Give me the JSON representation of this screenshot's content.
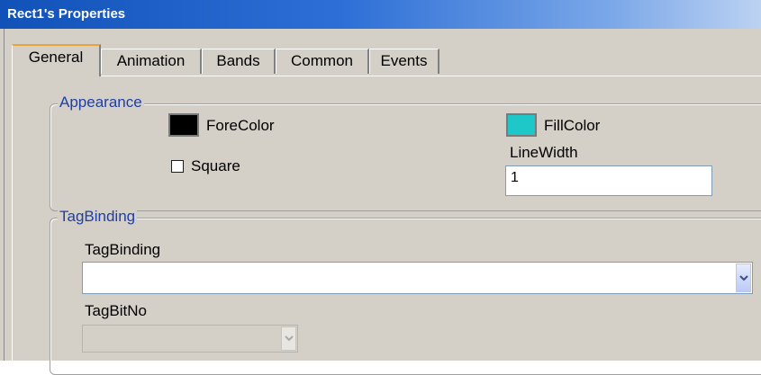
{
  "window": {
    "title": "Rect1's Properties"
  },
  "tabs": [
    {
      "label": "General",
      "active": true
    },
    {
      "label": "Animation",
      "active": false
    },
    {
      "label": "Bands",
      "active": false
    },
    {
      "label": "Common",
      "active": false
    },
    {
      "label": "Events",
      "active": false
    }
  ],
  "appearance": {
    "group_label": "Appearance",
    "fore_color": {
      "label": "ForeColor",
      "value": "#000000"
    },
    "fill_color": {
      "label": "FillColor",
      "value": "#1ec8c8"
    },
    "square": {
      "label": "Square",
      "checked": false
    },
    "line_width": {
      "label": "LineWidth",
      "value": "1"
    }
  },
  "tag_binding": {
    "group_label": "TagBinding",
    "binding": {
      "label": "TagBinding",
      "value": ""
    },
    "bit_no": {
      "label": "TagBitNo",
      "value": "",
      "disabled": true
    }
  },
  "colors": {
    "title_bar": "#1052b8",
    "group_label": "#1f3ea6",
    "active_tab_accent": "#e8a33b",
    "face": "#d4d0c8"
  }
}
